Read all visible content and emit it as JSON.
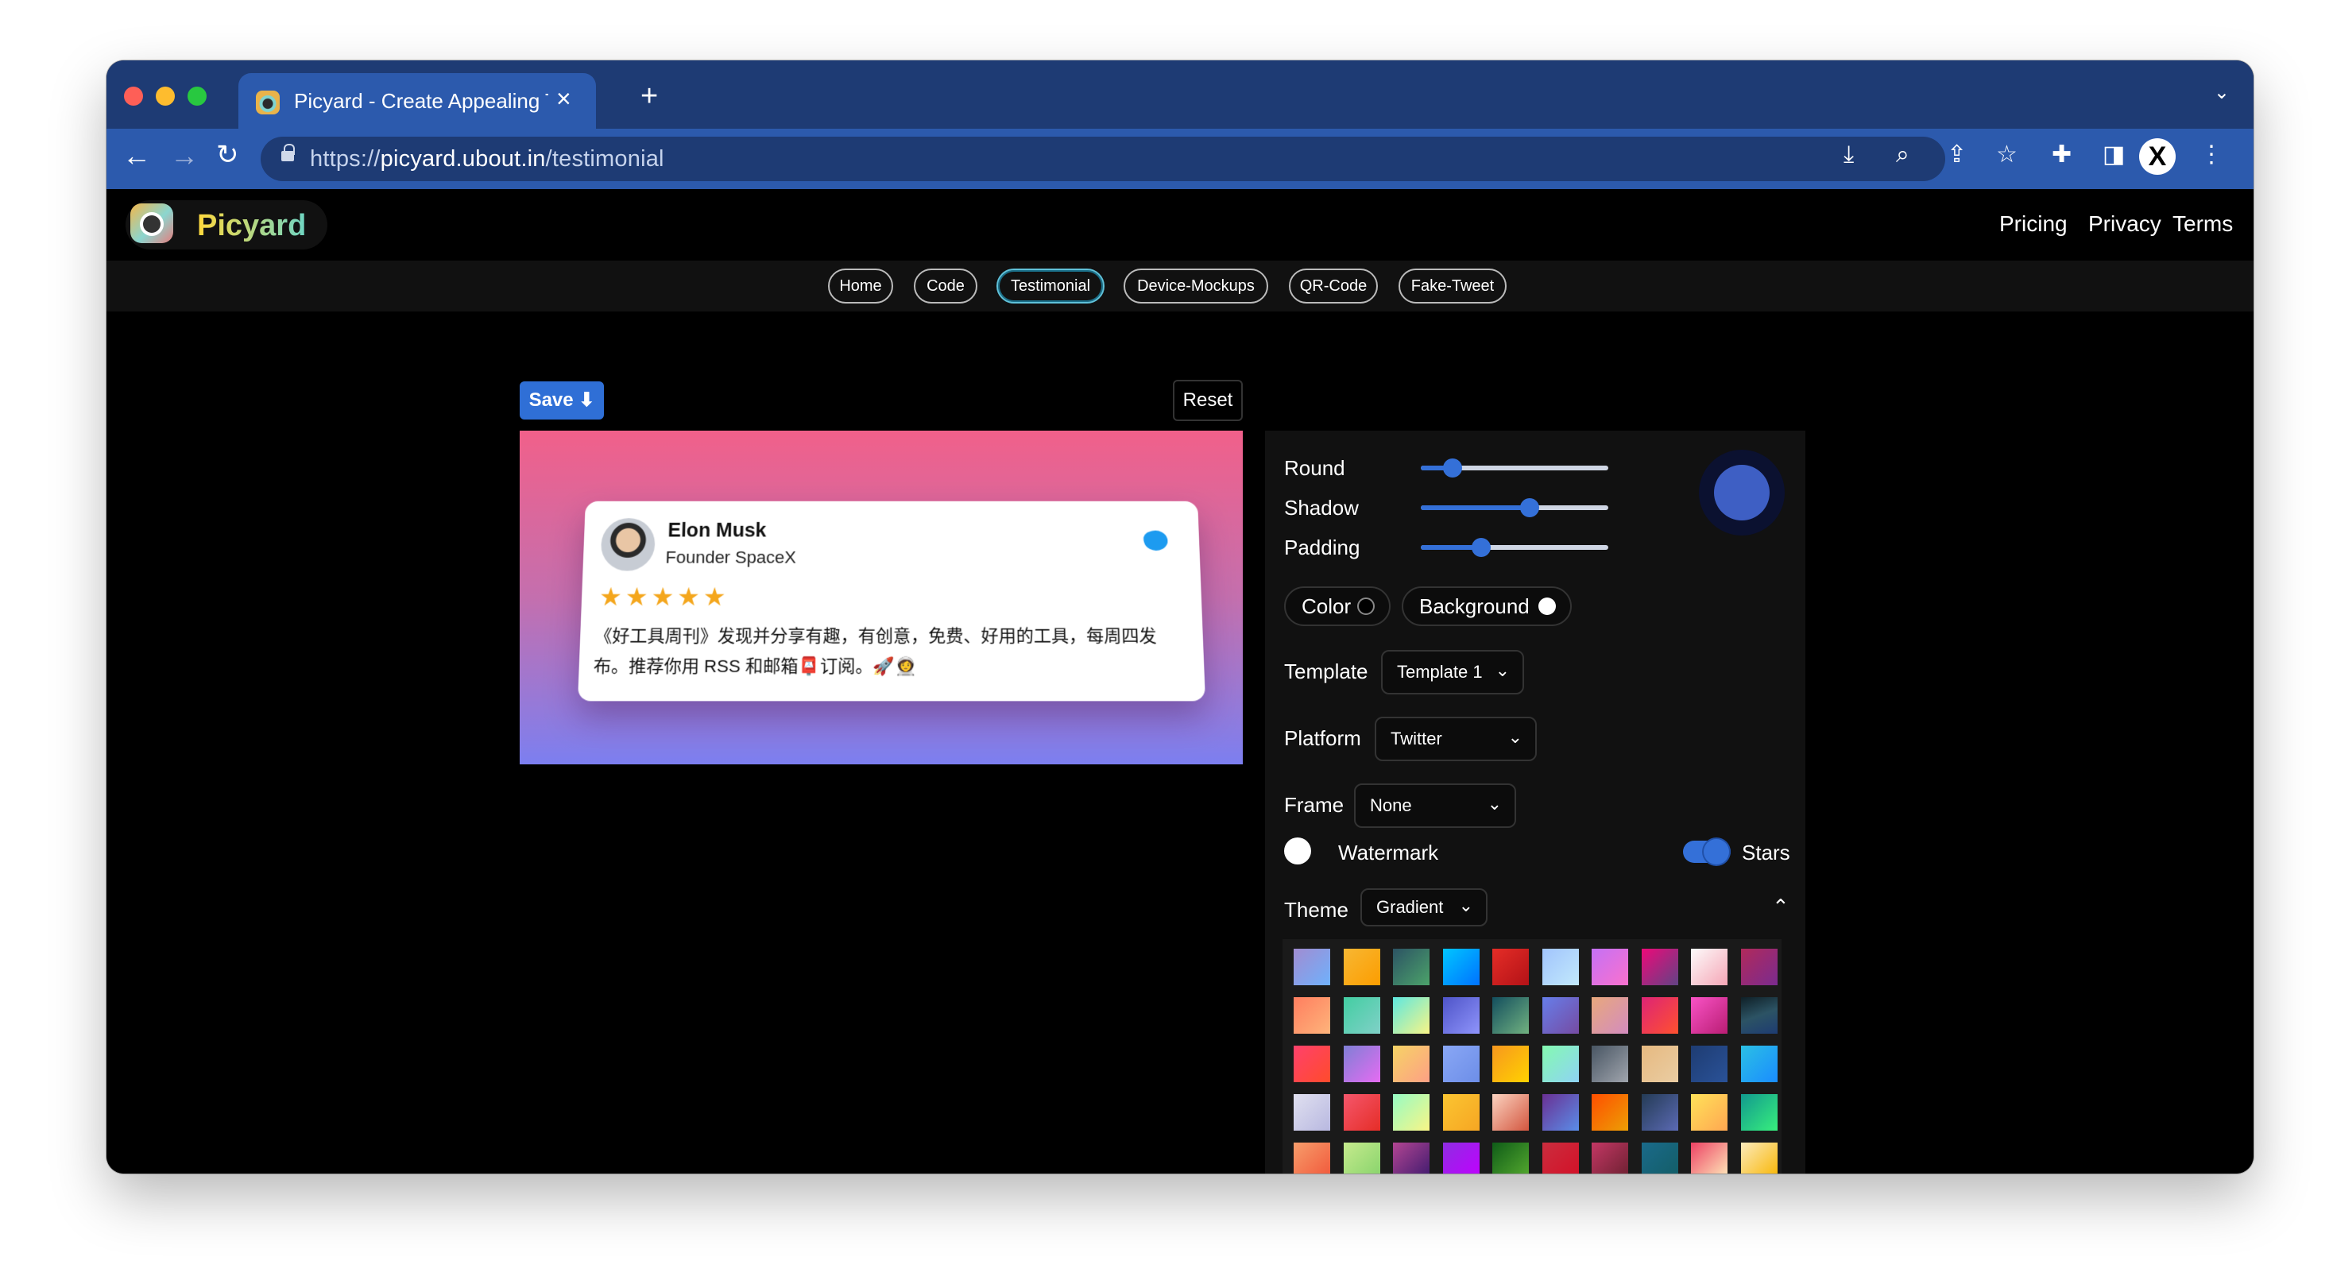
{
  "browser": {
    "tab_title": "Picyard - Create Appealing Tes",
    "tab_close": "×",
    "new_tab": "+",
    "tab_menu": "⌄",
    "url_scheme": "https://",
    "url_host": "picyard.ubout.in",
    "url_path": "/testimonial",
    "profile_initial": "X"
  },
  "header": {
    "brand": "Picyard",
    "links": [
      "Pricing",
      "Privacy",
      "Terms"
    ]
  },
  "subnav": {
    "items": [
      "Home",
      "Code",
      "Testimonial",
      "Device-Mockups",
      "QR-Code",
      "Fake-Tweet"
    ],
    "active": "Testimonial"
  },
  "actions": {
    "save_label": "Save ⬇",
    "reset_label": "Reset"
  },
  "testimonial": {
    "name": "Elon Musk",
    "title": "Founder SpaceX",
    "stars": "★★★★★",
    "rating": 5,
    "text": "《好工具周刊》发现并分享有趣，有创意，免费、好用的工具，每周四发布。推荐你用 RSS 和邮箱📮订阅。🚀👩‍🚀"
  },
  "panel": {
    "round_label": "Round",
    "round_value": 0.17,
    "shadow_label": "Shadow",
    "shadow_value": 0.58,
    "padding_label": "Padding",
    "padding_value": 0.32,
    "color_label": "Color",
    "background_label": "Background",
    "template_label": "Template",
    "template_value": "Template 1",
    "platform_label": "Platform",
    "platform_value": "Twitter",
    "frame_label": "Frame",
    "frame_value": "None",
    "watermark_label": "Watermark",
    "stars_label": "Stars",
    "stars_enabled": true,
    "theme_label": "Theme",
    "theme_value": "Gradient",
    "accent_color": "#3470d8"
  },
  "gradients": [
    "linear-gradient(135deg,#a18cd1,#6fb1fc)",
    "linear-gradient(135deg,#f7b733,#fc9d00)",
    "linear-gradient(135deg,#2c5364,#4ca36a)",
    "linear-gradient(135deg,#00c6ff,#0072ff)",
    "linear-gradient(135deg,#e52d27,#b31217)",
    "linear-gradient(135deg,#a1c4fd,#c2e9fb)",
    "linear-gradient(135deg,#c471f5,#fa71cd)",
    "linear-gradient(135deg,#ee0979,#614385)",
    "linear-gradient(135deg,#fdfbfb,#f5a6b6)",
    "linear-gradient(135deg,#b12a5b,#7a2b8f)",
    "linear-gradient(135deg,#ff7e5f,#feb47b)",
    "linear-gradient(135deg,#43cea2,#80d0c7)",
    "linear-gradient(135deg,#5ee7df,#f9f586)",
    "linear-gradient(135deg,#4e54c8,#8f94fb)",
    "linear-gradient(135deg,#134e5e,#71b280)",
    "linear-gradient(135deg,#667eea,#764ba2)",
    "linear-gradient(135deg,#e8a87c,#d38cbf)",
    "linear-gradient(135deg,#dd2476,#ff512f)",
    "linear-gradient(135deg,#f953c6,#b91d73)",
    "linear-gradient(160deg,#0f2027,#2c5364,#1e3c72)",
    "linear-gradient(135deg,#ff416c,#ff4b2b)",
    "linear-gradient(135deg,#7f7fd5,#e56cf2)",
    "linear-gradient(135deg,#f6d365,#fda085)",
    "linear-gradient(135deg,#89a7f5,#6d8ee8)",
    "linear-gradient(135deg,#f7971e,#ffd200)",
    "linear-gradient(135deg,#84fab0,#8fd3f4)",
    "linear-gradient(135deg,#485563,#a0a5ad)",
    "linear-gradient(135deg,#e6b980,#eacda3)",
    "linear-gradient(135deg,#1e3c72,#2a5298)",
    "linear-gradient(135deg,#2bc0e4,#1a8cff)",
    "linear-gradient(135deg,#e0e0f0,#b8b8e0)",
    "linear-gradient(135deg,#f5576c,#e52d27)",
    "linear-gradient(135deg,#96fbc4,#f9f586)",
    "linear-gradient(135deg,#fbc531,#f6a623)",
    "linear-gradient(135deg,#fbd3c0,#d3563f)",
    "linear-gradient(135deg,#6a3093,#5a8de8)",
    "linear-gradient(135deg,#ff4e00,#ec9f05)",
    "linear-gradient(135deg,#243b55,#5b6ab4)",
    "linear-gradient(135deg,#ffe259,#ffa751)",
    "linear-gradient(135deg,#11998e,#38ef7d)",
    "linear-gradient(135deg,#f79d6b,#f1573a)",
    "linear-gradient(135deg,#c6ea8d,#86d36b)",
    "linear-gradient(135deg,#b24592,#3d1a6e)",
    "linear-gradient(135deg,#8e2de2,#c100ff)",
    "linear-gradient(135deg,#0f5c18,#56ab2f)",
    "linear-gradient(135deg,#cb2d3e,#d31027)",
    "linear-gradient(135deg,#c33764,#6b2030)",
    "linear-gradient(135deg,#1a6a8a,#135d66)",
    "linear-gradient(135deg,#ed4264,#ffedbc)",
    "linear-gradient(135deg,#fceabb,#f8b500)",
    "linear-gradient(135deg,#7b4397,#dc2430)",
    "linear-gradient(135deg,#f6f3c9,#d8e8b8)",
    "linear-gradient(135deg,#2b5876,#4e4376)",
    "linear-gradient(135deg,#ff8008,#ffc837)",
    "linear-gradient(135deg,#f1998d,#d9687b)",
    "linear-gradient(135deg,#2c3e50,#4ca1af)",
    "linear-gradient(135deg,#3a4fa6,#5c5da8)",
    "linear-gradient(135deg,#1c2d2d,#2f4f4f)",
    "linear-gradient(135deg,#141e30,#243b55,#5a3f9c)",
    "linear-gradient(135deg,#c44d58,#a0328c)",
    "linear-gradient(135deg,#3a6073,#16222a)",
    "linear-gradient(135deg,#2c3e8f,#1a2a6c)",
    "linear-gradient(135deg,#8a2be2,#4b0082)",
    "linear-gradient(135deg,#f0c27b,#4b1248)",
    "linear-gradient(135deg,#d31027,#ea384d)",
    "linear-gradient(135deg,#2e8b57,#1f4037)",
    "linear-gradient(135deg,#36d1dc,#5b86e5)",
    "linear-gradient(135deg,#232526,#414345)",
    "linear-gradient(135deg,#e94057,#8a2387)",
    "linear-gradient(135deg,#3f5efb,#fc466b)"
  ]
}
